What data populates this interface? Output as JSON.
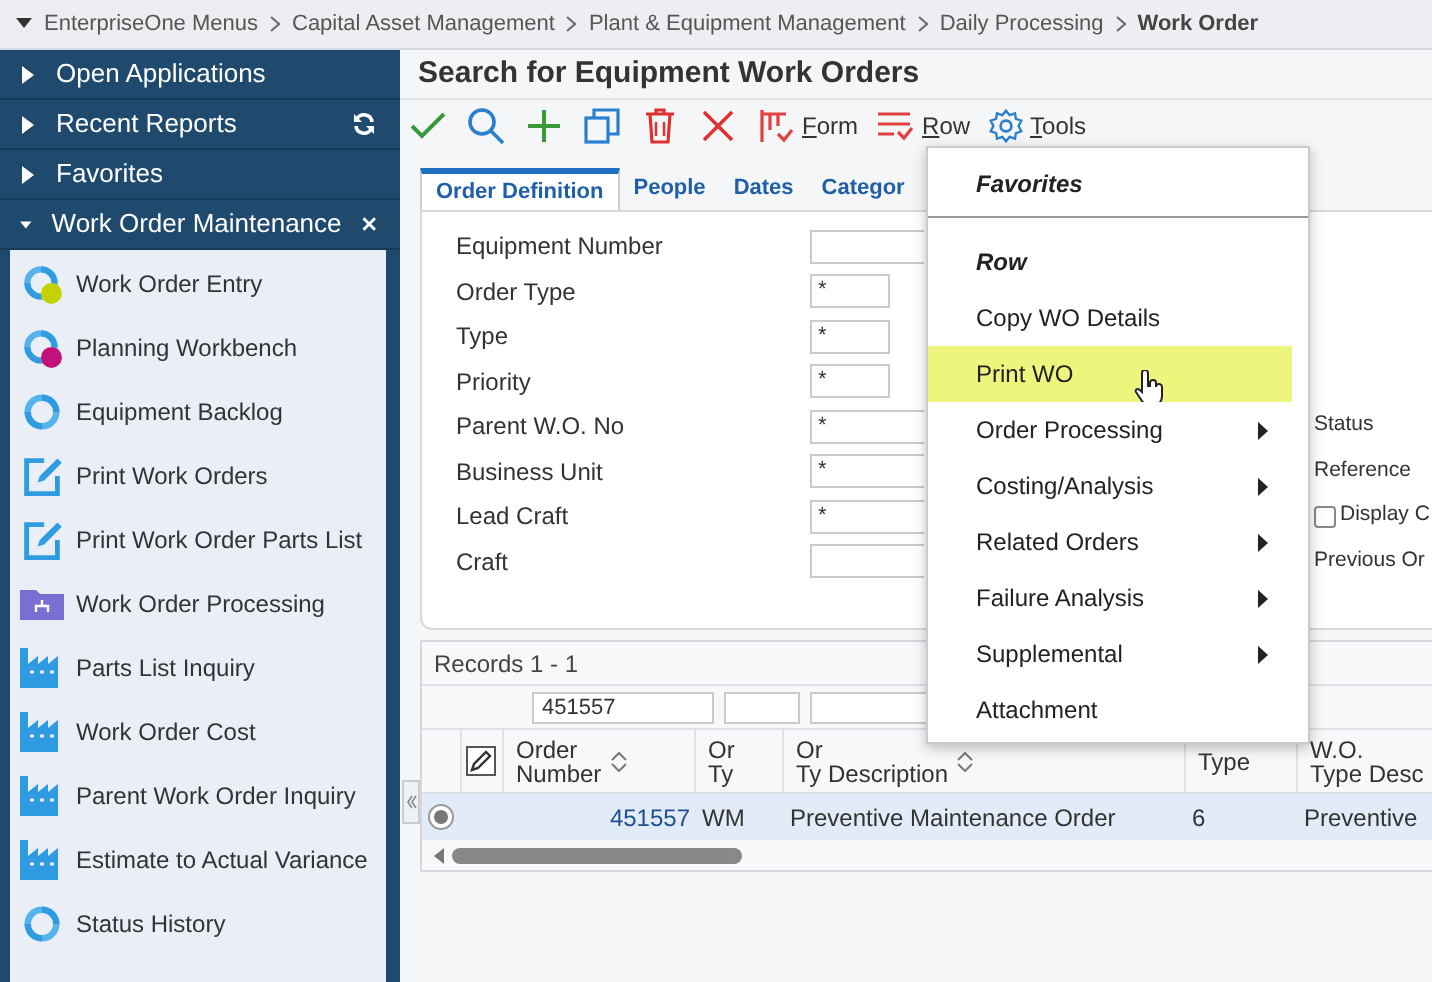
{
  "breadcrumb": {
    "items": [
      {
        "label": "EnterpriseOne Menus",
        "current": false
      },
      {
        "label": "Capital Asset Management",
        "current": false
      },
      {
        "label": "Plant & Equipment Management",
        "current": false
      },
      {
        "label": "Daily Processing",
        "current": false
      },
      {
        "label": "Work Order",
        "current": true
      }
    ]
  },
  "sidebar": {
    "sections": [
      {
        "label": "Open Applications",
        "expanded": false
      },
      {
        "label": "Recent Reports",
        "expanded": false,
        "refreshable": true
      },
      {
        "label": "Favorites",
        "expanded": false
      },
      {
        "label": "Work Order Maintenance",
        "expanded": true,
        "closable": true
      }
    ],
    "items": [
      {
        "label": "Work Order Entry",
        "kind": "cycle-green"
      },
      {
        "label": "Planning Workbench",
        "kind": "cycle-magenta"
      },
      {
        "label": "Equipment Backlog",
        "kind": "cycle"
      },
      {
        "label": "Print Work Orders",
        "kind": "edit"
      },
      {
        "label": "Print Work Order Parts List",
        "kind": "edit"
      },
      {
        "label": "Work Order Processing",
        "kind": "folder"
      },
      {
        "label": "Parts List Inquiry",
        "kind": "factory"
      },
      {
        "label": "Work Order Cost",
        "kind": "factory"
      },
      {
        "label": "Parent Work Order Inquiry",
        "kind": "factory"
      },
      {
        "label": "Estimate to Actual Variance",
        "kind": "factory"
      },
      {
        "label": "Status History",
        "kind": "cycle"
      }
    ]
  },
  "title": "Search for Equipment Work Orders",
  "toolbar": {
    "menus": [
      {
        "label": "Form",
        "kind": "form"
      },
      {
        "label": "Row",
        "kind": "row"
      },
      {
        "label": "Tools",
        "kind": "tools"
      }
    ]
  },
  "tabs": [
    {
      "label": "Order Definition",
      "selected": true
    },
    {
      "label": "People",
      "selected": false
    },
    {
      "label": "Dates",
      "selected": false
    },
    {
      "label": "Categor",
      "selected": false
    }
  ],
  "form": [
    {
      "label": "Equipment Number",
      "short": false
    },
    {
      "label": "Order Type",
      "value": "*",
      "short": true
    },
    {
      "label": "Type",
      "value": "*",
      "short": true
    },
    {
      "label": "Priority",
      "value": "*",
      "short": true
    },
    {
      "label": "Parent W.O. No",
      "value": "*",
      "short": false,
      "right": {
        "kind": "text",
        "label": "Status"
      }
    },
    {
      "label": "Business Unit",
      "value": "*",
      "short": false,
      "right": {
        "kind": "text",
        "label": "Reference"
      }
    },
    {
      "label": "Lead Craft",
      "value": "*",
      "short": false,
      "right": {
        "kind": "checkbox",
        "label": "Display C",
        "checked": false
      }
    },
    {
      "label": "Craft",
      "short": false,
      "right": {
        "kind": "text",
        "label": "Previous Or"
      }
    }
  ],
  "grid": {
    "records": "Records 1 - 1",
    "filters": [
      {
        "value": "451557"
      }
    ],
    "columns": [
      {
        "line1": "Order",
        "line2": "Number",
        "sortable": true
      },
      {
        "line1": "Or",
        "line2": "Ty",
        "sortable": false
      },
      {
        "line1": "Or",
        "line2": "Ty Description",
        "sortable": true
      },
      {
        "line2": "Type",
        "sortable": false
      },
      {
        "line1": "W.O.",
        "line2": "Type Desc"
      }
    ],
    "rows": [
      {
        "selected": true,
        "cells": [
          "451557",
          "WM",
          "Preventive Maintenance Order",
          "6",
          "Preventive"
        ]
      }
    ]
  },
  "menu": {
    "items": [
      {
        "label": "Favorites",
        "kind": "header"
      },
      {
        "label": "Row",
        "kind": "header"
      },
      {
        "label": "Copy WO Details",
        "kind": "item",
        "selected": false
      },
      {
        "label": "Print WO",
        "kind": "item",
        "selected": true
      },
      {
        "label": "Order Processing",
        "kind": "submenu",
        "selected": false
      },
      {
        "label": "Costing/Analysis",
        "kind": "submenu",
        "selected": false
      },
      {
        "label": "Related Orders",
        "kind": "submenu",
        "selected": false
      },
      {
        "label": "Failure Analysis",
        "kind": "submenu",
        "selected": false
      },
      {
        "label": "Supplemental",
        "kind": "submenu",
        "selected": false
      },
      {
        "label": "Attachment",
        "kind": "item",
        "selected": false
      }
    ]
  }
}
